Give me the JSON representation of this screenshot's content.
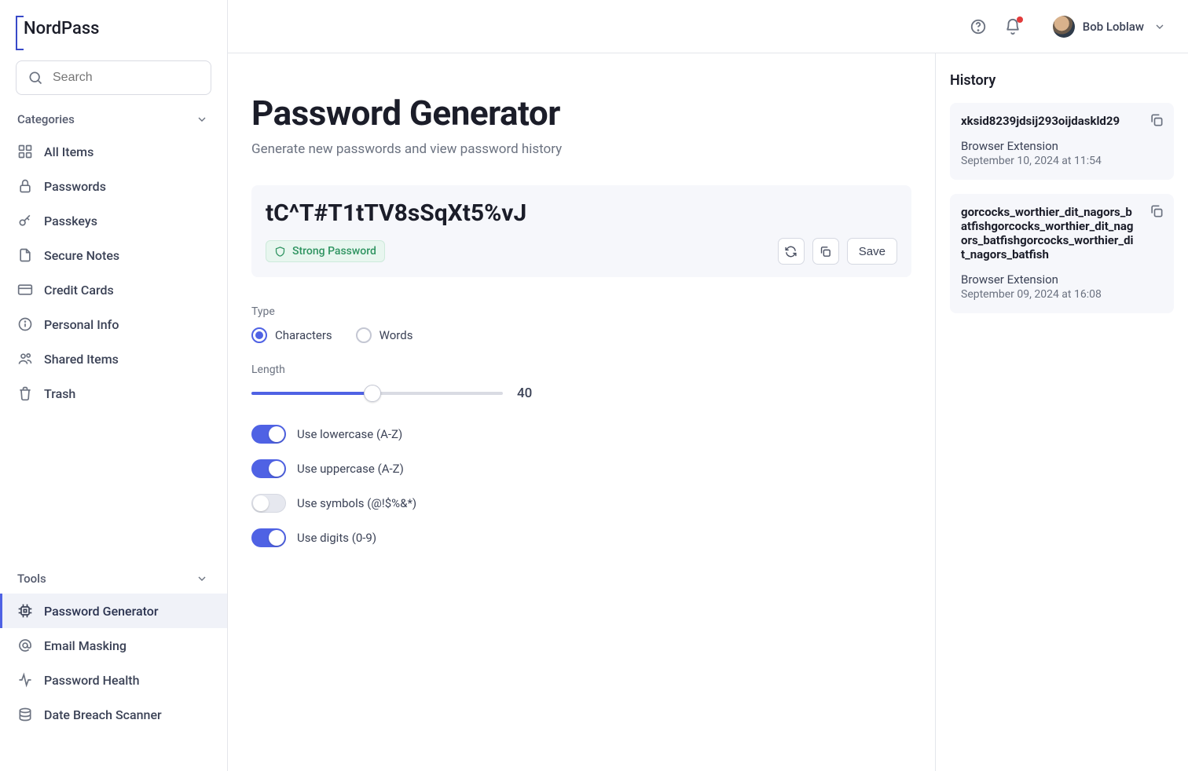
{
  "app": {
    "name": "NordPass"
  },
  "search": {
    "placeholder": "Search"
  },
  "topbar": {
    "user_name": "Bob Loblaw"
  },
  "sidebar": {
    "categories_header": "Categories",
    "categories": [
      {
        "id": "all-items",
        "label": "All Items"
      },
      {
        "id": "passwords",
        "label": "Passwords"
      },
      {
        "id": "passkeys",
        "label": "Passkeys"
      },
      {
        "id": "secure-notes",
        "label": "Secure Notes"
      },
      {
        "id": "credit-cards",
        "label": "Credit Cards"
      },
      {
        "id": "personal-info",
        "label": "Personal Info"
      },
      {
        "id": "shared-items",
        "label": "Shared Items"
      },
      {
        "id": "trash",
        "label": "Trash"
      }
    ],
    "tools_header": "Tools",
    "tools": [
      {
        "id": "password-generator",
        "label": "Password Generator",
        "active": true
      },
      {
        "id": "email-masking",
        "label": "Email Masking"
      },
      {
        "id": "password-health",
        "label": "Password Health"
      },
      {
        "id": "date-breach-scanner",
        "label": "Date Breach Scanner"
      }
    ]
  },
  "main": {
    "title": "Password Generator",
    "subtitle": "Generate new passwords and view password history",
    "password": "tC^T#T1tTV8sSqXt5%vJ",
    "strength_badge": "Strong Password",
    "save_label": "Save",
    "type_label": "Type",
    "type_options": {
      "characters": "Characters",
      "words": "Words"
    },
    "type_selected": "characters",
    "length_label": "Length",
    "length_value": "40",
    "toggles": {
      "lowercase": {
        "label": "Use lowercase (A-Z)",
        "on": true
      },
      "uppercase": {
        "label": "Use uppercase (A-Z)",
        "on": true
      },
      "symbols": {
        "label": "Use symbols (@!$%&*)",
        "on": false
      },
      "digits": {
        "label": "Use digits (0-9)",
        "on": true
      }
    }
  },
  "history": {
    "title": "History",
    "items": [
      {
        "password": "xksid8239jdsij293oijdaskld29",
        "source": "Browser Extension",
        "timestamp": "September 10, 2024 at 11:54"
      },
      {
        "password": "gorcocks_worthier_dit_nagors_batfishgorcocks_worthier_dit_nagors_batfishgorcocks_worthier_dit_nagors_batfish",
        "source": "Browser Extension",
        "timestamp": "September 09, 2024 at 16:08"
      }
    ]
  }
}
